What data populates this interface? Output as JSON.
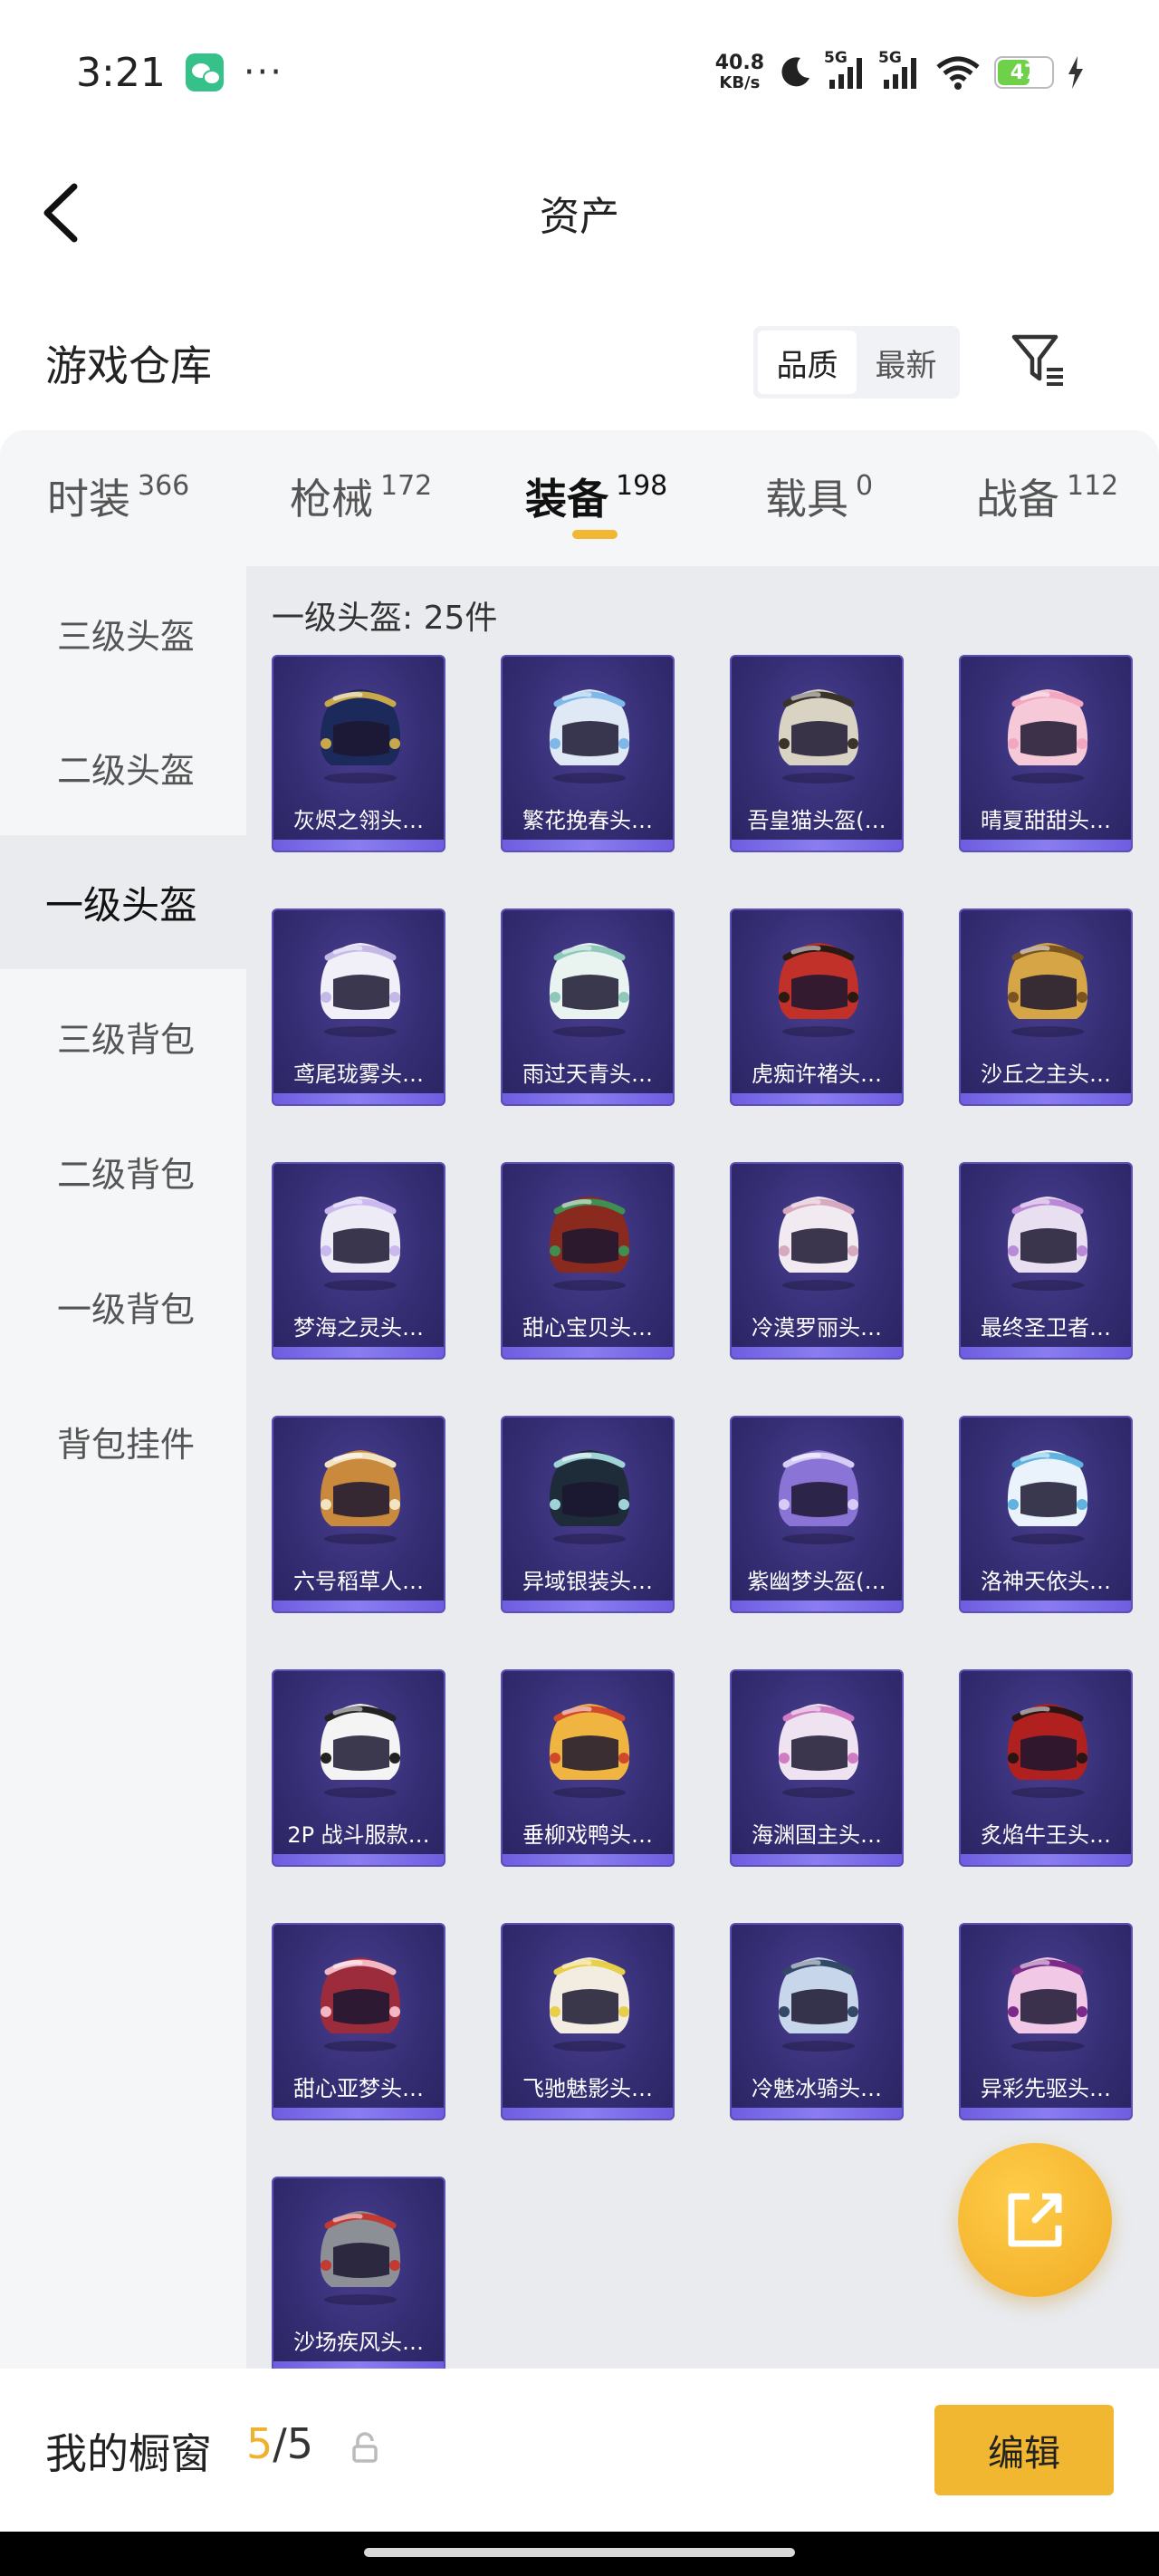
{
  "status_bar": {
    "time": "3:21",
    "net_speed_value": "40.8",
    "net_speed_unit": "KB/s",
    "signal_tag_1": "5G",
    "signal_tag_2": "5G",
    "battery": "47",
    "icons": [
      "wechat-icon",
      "more-dots-icon",
      "moon-icon",
      "signal-icon",
      "wifi-icon",
      "battery-icon",
      "charging-icon"
    ]
  },
  "header": {
    "title": "资产"
  },
  "warehouse": {
    "title": "游戏仓库",
    "sort_options": [
      "品质",
      "最新"
    ],
    "sort_selected": "品质"
  },
  "tabs": [
    {
      "label": "时装",
      "count": "366",
      "active": false
    },
    {
      "label": "枪械",
      "count": "172",
      "active": false
    },
    {
      "label": "装备",
      "count": "198",
      "active": true
    },
    {
      "label": "载具",
      "count": "0",
      "active": false
    },
    {
      "label": "战备",
      "count": "112",
      "active": false
    }
  ],
  "sidebar": {
    "items": [
      "三级头盔",
      "二级头盔",
      "一级头盔",
      "三级背包",
      "二级背包",
      "一级背包",
      "背包挂件"
    ],
    "active_index": 2
  },
  "grid": {
    "title": "一级头盔: 25件",
    "items": [
      {
        "name": "灰烬之翎头…",
        "color": "#1b2a5a",
        "accent": "#c8a84a"
      },
      {
        "name": "繁花挽春头…",
        "color": "#dfe9f5",
        "accent": "#7fb8e8"
      },
      {
        "name": "吾皇猫头盔(…",
        "color": "#d9d3c4",
        "accent": "#3a332a"
      },
      {
        "name": "晴夏甜甜头…",
        "color": "#f6c9d8",
        "accent": "#f2a6bf"
      },
      {
        "name": "鸢尾珑雾头…",
        "color": "#f1f0f8",
        "accent": "#c4b8e6"
      },
      {
        "name": "雨过天青头…",
        "color": "#e9f3ef",
        "accent": "#8fc8bb"
      },
      {
        "name": "虎痴许褚头…",
        "color": "#c2302a",
        "accent": "#2a1b12"
      },
      {
        "name": "沙丘之主头…",
        "color": "#d6a646",
        "accent": "#7a5420"
      },
      {
        "name": "梦海之灵头…",
        "color": "#ecebf6",
        "accent": "#c9b9ef"
      },
      {
        "name": "甜心宝贝头…",
        "color": "#8a2a1e",
        "accent": "#3f8f52"
      },
      {
        "name": "冷漠罗丽头…",
        "color": "#f1eaf0",
        "accent": "#d6a9c0"
      },
      {
        "name": "最终圣卫者…",
        "color": "#e8dff0",
        "accent": "#b98ad8"
      },
      {
        "name": "六号稻草人…",
        "color": "#c98a3e",
        "accent": "#f2e3c2"
      },
      {
        "name": "异域银装头…",
        "color": "#1e2b38",
        "accent": "#9fd3d8"
      },
      {
        "name": "紫幽梦头盔(…",
        "color": "#8a74d6",
        "accent": "#d6ccf5"
      },
      {
        "name": "洛神天依头…",
        "color": "#eaf3fb",
        "accent": "#5fb3de"
      },
      {
        "name": "2P 战斗服款…",
        "color": "#f4f4f4",
        "accent": "#222222"
      },
      {
        "name": "垂柳戏鸭头…",
        "color": "#f0b441",
        "accent": "#d0492a"
      },
      {
        "name": "海渊国主头…",
        "color": "#efe3f2",
        "accent": "#d07cc4"
      },
      {
        "name": "炙焰牛王头…",
        "color": "#b0201e",
        "accent": "#2b1414"
      },
      {
        "name": "甜心亚梦头…",
        "color": "#9c2c3c",
        "accent": "#f2b9c4"
      },
      {
        "name": "飞驰魅影头…",
        "color": "#f2ede0",
        "accent": "#e8cf4a"
      },
      {
        "name": "冷魅冰骑头…",
        "color": "#c7d6ea",
        "accent": "#334866"
      },
      {
        "name": "异彩先驱头…",
        "color": "#f1c8e6",
        "accent": "#7b2a8a"
      },
      {
        "name": "沙场疾风头…",
        "color": "#8d8f96",
        "accent": "#c23b33"
      }
    ]
  },
  "bottom": {
    "showcase_label": "我的橱窗",
    "showcase_current": "5",
    "showcase_separator": "/",
    "showcase_total": "5",
    "edit_label": "编辑"
  },
  "colors": {
    "accent": "#f2b731",
    "tab_underline": "#f1b632",
    "item_card_bg": "#352e74"
  }
}
